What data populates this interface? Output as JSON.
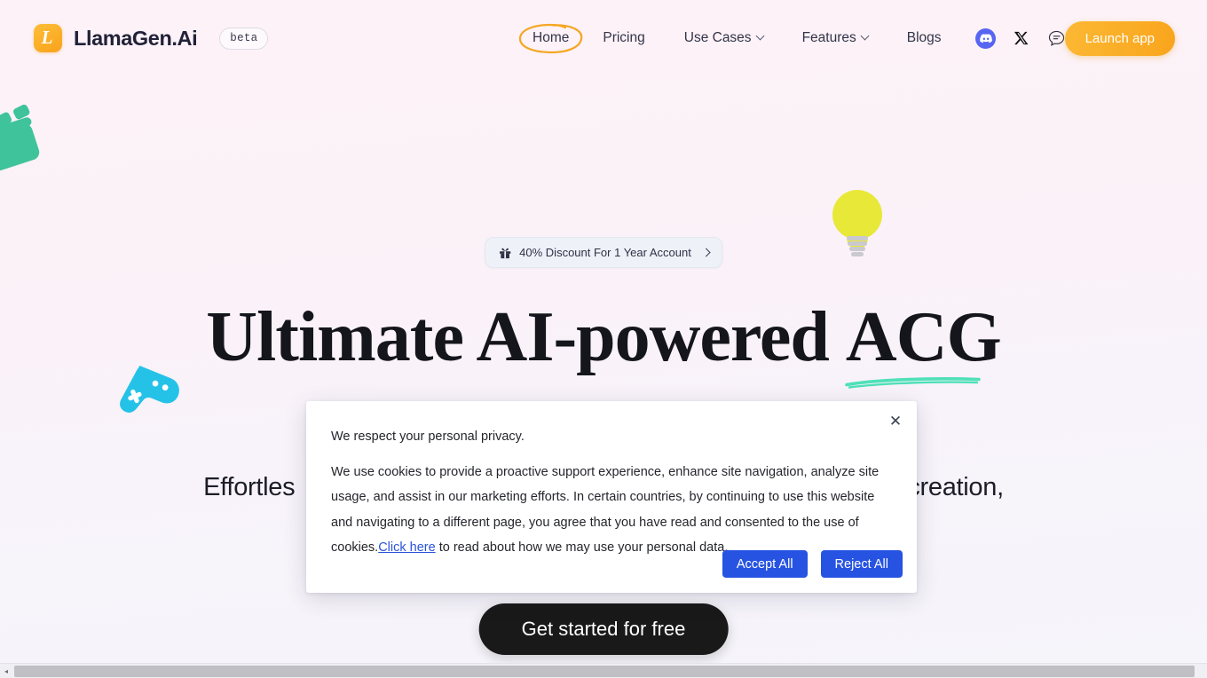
{
  "theme": {
    "bg_top": "#fcf2f8",
    "bg_bottom": "#f5f5fa",
    "brand_orange": "#f9a51d",
    "accent_blue": "#2753e2",
    "discord_purple": "#5865f2",
    "cta_dark": "#191919",
    "underline_teal": "#4fe0b8"
  },
  "header": {
    "logo_letter": "L",
    "brand_name": "LlamaGen.Ai",
    "beta_label": "beta",
    "nav": [
      {
        "label": "Home",
        "has_chevron": false,
        "active": true
      },
      {
        "label": "Pricing",
        "has_chevron": false,
        "active": false
      },
      {
        "label": "Use Cases",
        "has_chevron": true,
        "active": false
      },
      {
        "label": "Features",
        "has_chevron": true,
        "active": false
      },
      {
        "label": "Blogs",
        "has_chevron": false,
        "active": false
      }
    ],
    "social": [
      {
        "name": "discord-icon"
      },
      {
        "name": "x-twitter-icon"
      },
      {
        "name": "chat-bubble-icon"
      }
    ],
    "launch_label": "Launch app"
  },
  "hero": {
    "discount_text": "40% Discount For 1 Year Account",
    "discount_icon": "gift-icon",
    "headline_line1_a": "Ultimate AI-powered ",
    "headline_line1_b": "ACG",
    "subhead_left": "Effortles",
    "subhead_right": "creation,",
    "cta_label": "Get started for free"
  },
  "decor": [
    {
      "name": "clapperboard-decoration",
      "color": "#3fc39a"
    },
    {
      "name": "game-controller-decoration",
      "color": "#25c2e8"
    },
    {
      "name": "lightbulb-decoration",
      "color": "#e8e839"
    }
  ],
  "cookie_modal": {
    "close_icon": "close-icon",
    "title": "We respect your personal privacy.",
    "body_part1": "We use cookies to provide a proactive support experience, enhance site navigation, analyze site usage, and assist in our marketing efforts. In certain countries, by continuing to use this website and navigating to a different page, you agree that you have read and consented to the use of cookies.",
    "link_text": "Click here",
    "body_part2": " to read about how we may use your personal data.",
    "accept_label": "Accept All",
    "reject_label": "Reject All"
  },
  "scrollbar": {
    "left_arrow": "◂"
  }
}
